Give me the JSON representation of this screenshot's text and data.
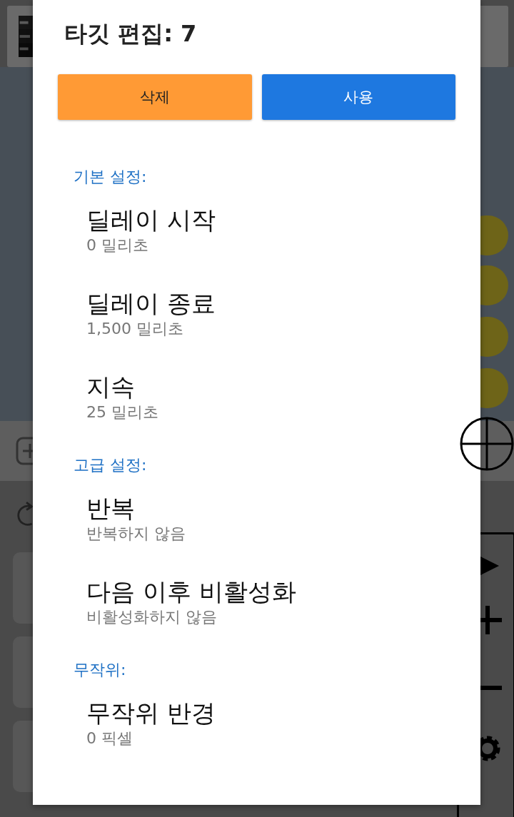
{
  "dialog": {
    "title": "타깃 편집: 7",
    "buttons": [
      {
        "label": "삭제",
        "kind": "danger"
      },
      {
        "label": "사용",
        "kind": "primary"
      }
    ],
    "sections": [
      {
        "header": "기본 설정:",
        "items": [
          {
            "title": "딜레이 시작",
            "value": "0 밀리초"
          },
          {
            "title": "딜레이 종료",
            "value": "1,500 밀리초"
          },
          {
            "title": "지속",
            "value": "25 밀리초"
          }
        ]
      },
      {
        "header": "고급 설정:",
        "items": [
          {
            "title": "반복",
            "value": "반복하지 않음"
          },
          {
            "title": "다음 이후 비활성화",
            "value": "비활성화하지 않음"
          }
        ]
      },
      {
        "header": "무작위:",
        "items": [
          {
            "title": "무작위 반경",
            "value": "0 픽셀"
          }
        ]
      }
    ]
  }
}
